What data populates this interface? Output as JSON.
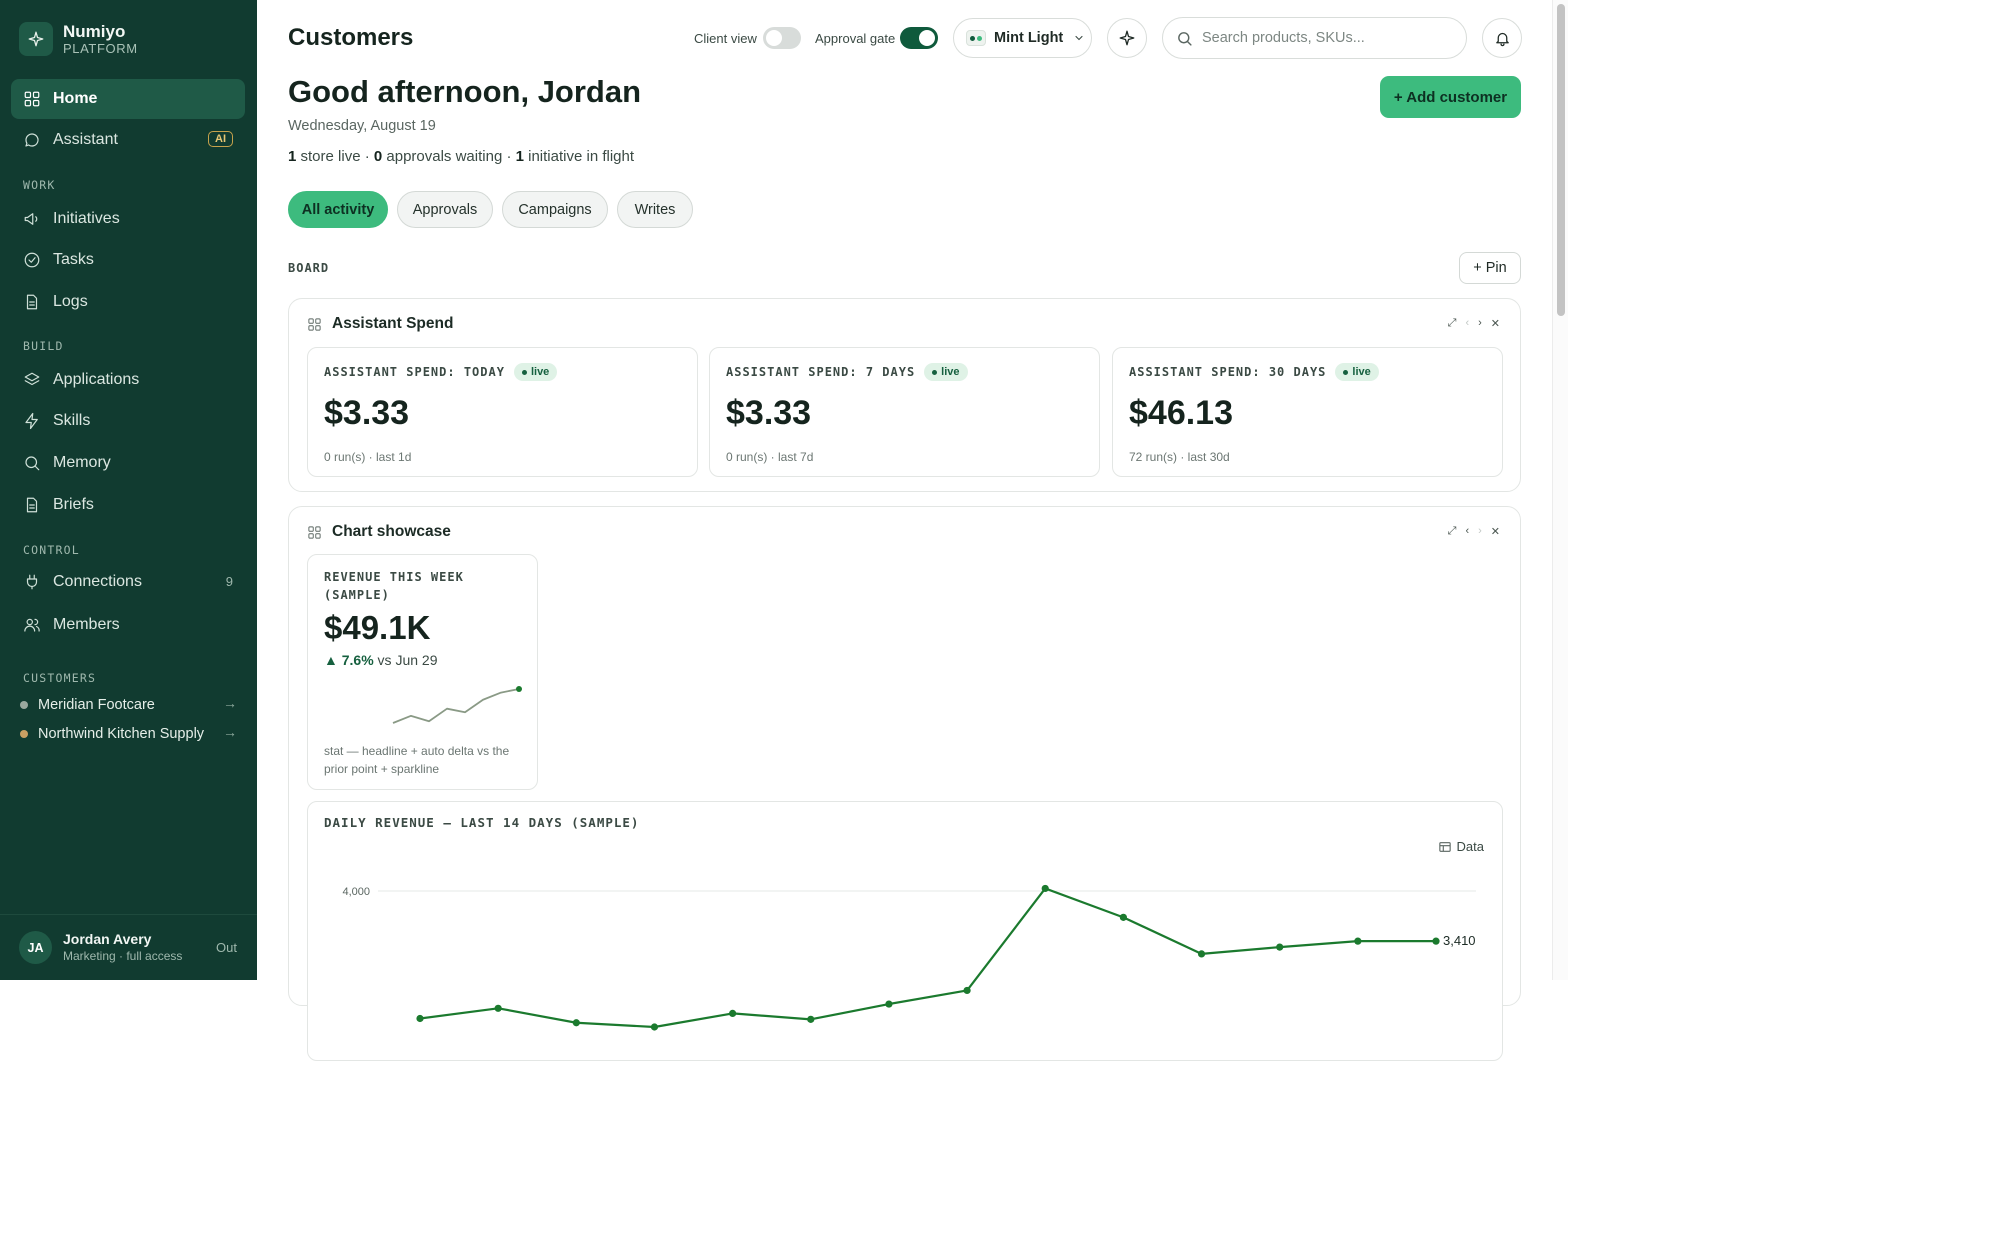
{
  "brand": {
    "name": "Numiyo",
    "subtitle": "PLATFORM",
    "icon": "sparkle-icon"
  },
  "nav": {
    "home": {
      "label": "Home",
      "icon": "grid-icon"
    },
    "assistant": {
      "label": "Assistant",
      "badge": "AI",
      "icon": "chat-bubble-icon"
    },
    "sections": {
      "work": "WORK",
      "build": "BUILD",
      "control": "CONTROL",
      "customers": "CUSTOMERS"
    },
    "initiatives": {
      "label": "Initiatives",
      "icon": "megaphone-icon"
    },
    "tasks": {
      "label": "Tasks",
      "icon": "check-circle-icon"
    },
    "logs": {
      "label": "Logs",
      "icon": "document-icon"
    },
    "applications": {
      "label": "Applications",
      "icon": "layers-icon"
    },
    "skills": {
      "label": "Skills",
      "icon": "lightning-icon"
    },
    "memory": {
      "label": "Memory",
      "icon": "search-icon"
    },
    "briefs": {
      "label": "Briefs",
      "icon": "document-icon"
    },
    "connections": {
      "label": "Connections",
      "count": "9",
      "icon": "plug-icon"
    },
    "members": {
      "label": "Members",
      "icon": "users-icon"
    }
  },
  "customers": [
    {
      "name": "Meridian Footcare",
      "color": "#9aa89e"
    },
    {
      "name": "Northwind Kitchen Supply",
      "color": "#c9a063"
    }
  ],
  "user": {
    "initials": "JA",
    "name": "Jordan Avery",
    "role": "Marketing · full access",
    "signout": "Out"
  },
  "header": {
    "title": "Customers",
    "client_view": {
      "label": "Client view",
      "on": false
    },
    "approval_gate": {
      "label": "Approval gate",
      "on": true
    },
    "theme": {
      "label": "Mint Light"
    },
    "search": {
      "placeholder": "Search products, SKUs..."
    }
  },
  "hero": {
    "greeting": "Good afternoon, Jordan",
    "date": "Wednesday, August 19",
    "summary": {
      "stores": "1",
      "stores_text": " store live · ",
      "approvals": "0",
      "approvals_text": " approvals waiting · ",
      "initiatives": "1",
      "initiatives_text": " initiative in flight"
    },
    "add_button": "+ Add customer"
  },
  "filters": [
    "All activity",
    "Approvals",
    "Campaigns",
    "Writes"
  ],
  "board": {
    "label": "BOARD",
    "pin": "+ Pin"
  },
  "spend_panel": {
    "title": "Assistant Spend",
    "live_label": "live",
    "cards": [
      {
        "label": "ASSISTANT SPEND: TODAY",
        "value": "$3.33",
        "sub": "0 run(s) · last 1d"
      },
      {
        "label": "ASSISTANT SPEND: 7 DAYS",
        "value": "$3.33",
        "sub": "0 run(s) · last 7d"
      },
      {
        "label": "ASSISTANT SPEND: 30 DAYS",
        "value": "$46.13",
        "sub": "72 run(s) · last 30d"
      }
    ]
  },
  "chart_panel": {
    "title": "Chart showcase",
    "stat": {
      "label": "REVENUE THIS WEEK (SAMPLE)",
      "value": "$49.1K",
      "delta_arrow": "▲",
      "delta": "7.6%",
      "delta_text": " vs Jun 29",
      "note": "stat — headline + auto delta vs the prior point + sparkline"
    },
    "line_card": {
      "title": "DAILY REVENUE — LAST 14 DAYS (SAMPLE)",
      "data_button": "Data"
    }
  },
  "chart_data": [
    {
      "type": "line",
      "title": "",
      "series": [
        {
          "values": [
            2.0,
            2.4,
            2.1,
            2.8,
            2.6,
            3.3,
            3.7,
            3.9
          ]
        }
      ],
      "color": "#8a9a86"
    },
    {
      "type": "line",
      "title": "DAILY REVENUE — LAST 14 DAYS (SAMPLE)",
      "x": [
        1,
        2,
        3,
        4,
        5,
        6,
        7,
        8,
        9,
        10,
        11,
        12,
        13,
        14
      ],
      "series": [
        {
          "values": [
            2500,
            2620,
            2450,
            2400,
            2560,
            2490,
            2670,
            2830,
            4030,
            3690,
            3260,
            3340,
            3410,
            3410
          ]
        }
      ],
      "ytick_labels": [
        "4,000"
      ],
      "end_label": "3,410",
      "ylim": [
        2400,
        4100
      ],
      "grid": true,
      "color": "#1b7a2e"
    }
  ]
}
